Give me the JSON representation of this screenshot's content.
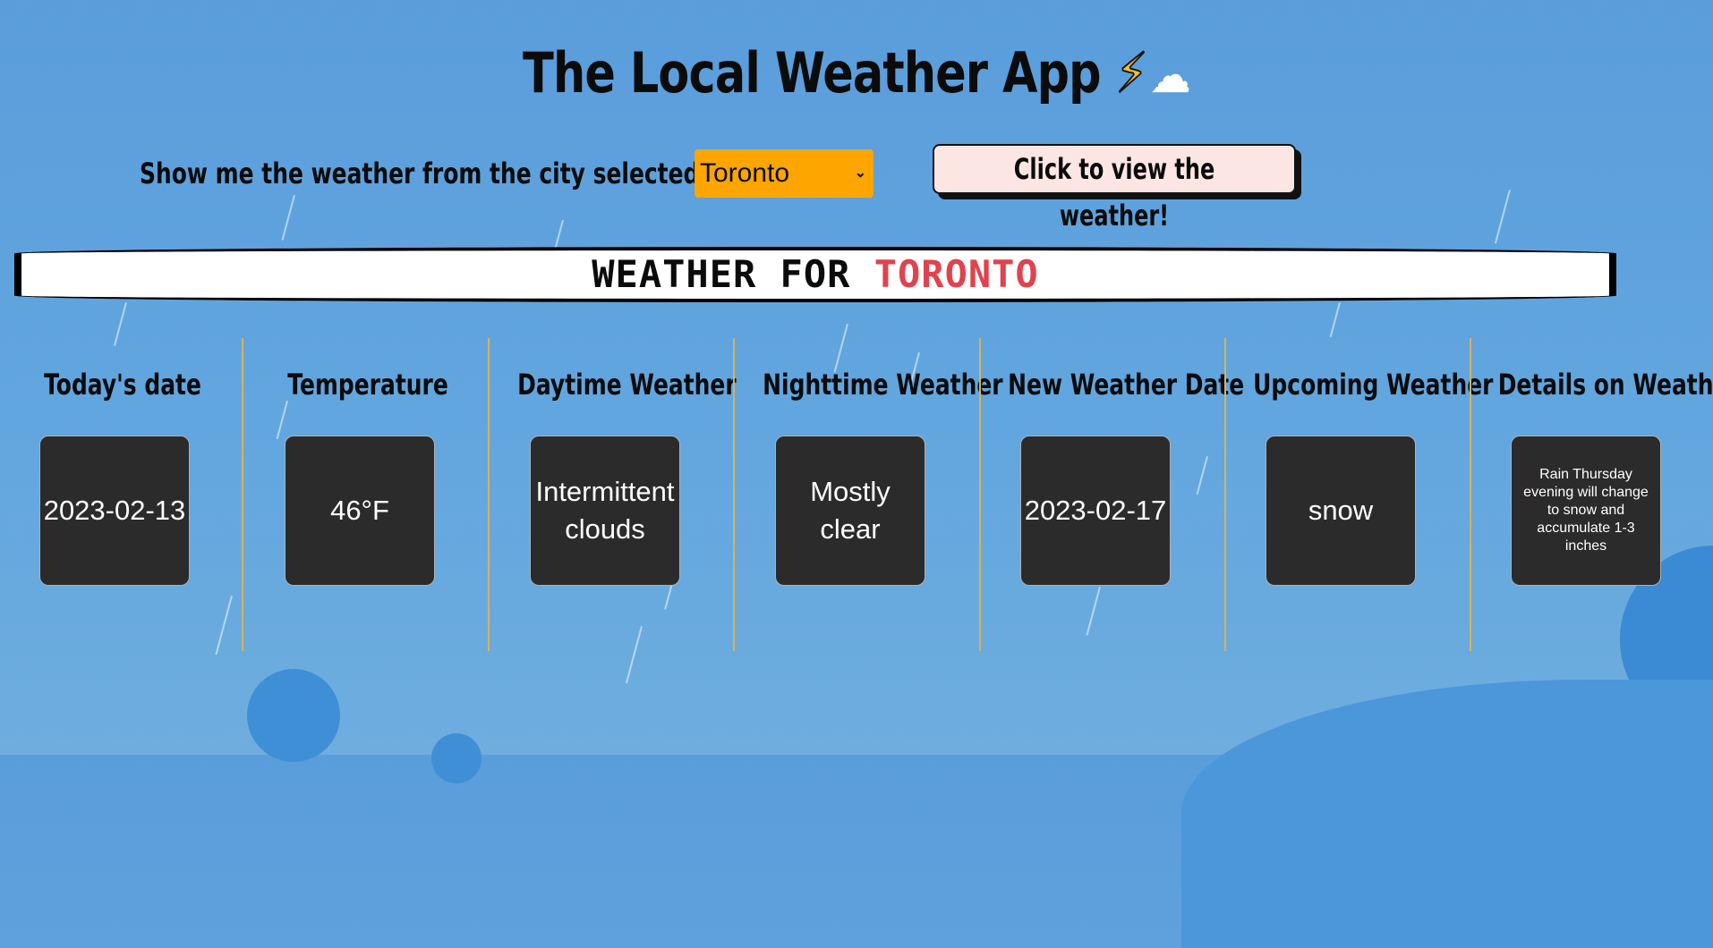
{
  "app": {
    "title": "The Local Weather App",
    "title_emoji_bolt": "⚡",
    "title_emoji_cloud": "☁"
  },
  "controls": {
    "prompt_label": "Show me the weather from the city selected ➞",
    "city_select_value": "Toronto",
    "view_button_label": "Click to view the weather!"
  },
  "banner": {
    "prefix": "WEATHER FOR",
    "city": "TORONTO"
  },
  "columns": [
    {
      "heading": "Today's date",
      "value": "2023-02-13"
    },
    {
      "heading": "Temperature",
      "value": "46°F"
    },
    {
      "heading": "Daytime Weather",
      "value": "Intermittent clouds"
    },
    {
      "heading": "Nighttime Weather",
      "value": "Mostly clear"
    },
    {
      "heading": "New Weather Date",
      "value": "2023-02-17"
    },
    {
      "heading": "Upcoming Weather",
      "value": "snow"
    },
    {
      "heading": "Details on Weather",
      "value": "Rain Thursday evening will change to snow and accumulate 1-3 inches"
    }
  ],
  "colors": {
    "background": "#5a9ddb",
    "select_background": "#ffa500",
    "button_background": "#fce6e4",
    "banner_city": "#e0434d",
    "tile_background": "#2b2b2b",
    "divider": "#d8b25a"
  }
}
